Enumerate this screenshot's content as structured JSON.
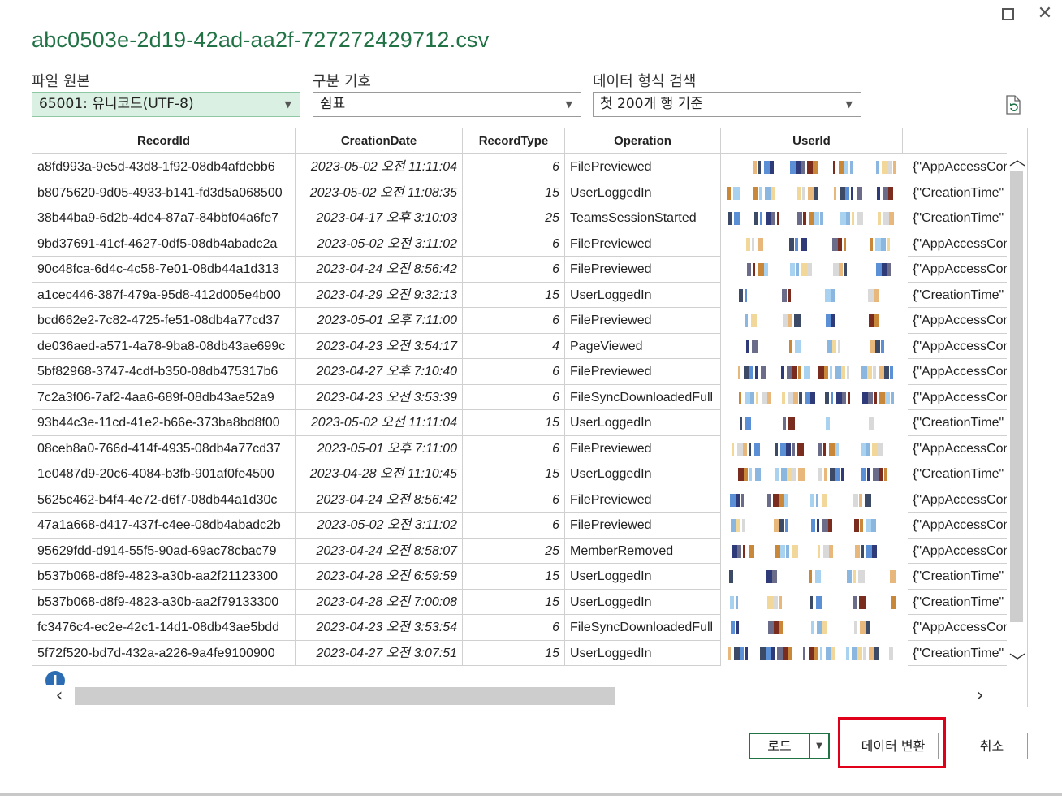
{
  "window": {
    "maximize_icon": "maximize-icon",
    "close_icon": "close-icon",
    "close_glyph": "✕"
  },
  "title": "abc0503e-2d19-42ad-aa2f-727272429712.csv",
  "fields": {
    "file_origin": {
      "label": "파일 원본",
      "value": "65001: 유니코드(UTF-8)"
    },
    "delimiter": {
      "label": "구분 기호",
      "value": "쉼표"
    },
    "type_detection": {
      "label": "데이터 형식 검색",
      "value": "첫 200개 행 기준"
    }
  },
  "columns": [
    "RecordId",
    "CreationDate",
    "RecordType",
    "Operation",
    "UserId"
  ],
  "rows": [
    {
      "id": "a8fd993a-9e5d-43d8-1f92-08db4afdebb6",
      "date": "2023-05-02 오전 11:11:04",
      "type": "6",
      "op": "FilePreviewed",
      "data": "{\"AppAccessCon"
    },
    {
      "id": "b8075620-9d05-4933-b141-fd3d5a068500",
      "date": "2023-05-02 오전 11:08:35",
      "type": "15",
      "op": "UserLoggedIn",
      "data": "{\"CreationTime\""
    },
    {
      "id": "38b44ba9-6d2b-4de4-87a7-84bbf04a6fe7",
      "date": "2023-04-17 오후 3:10:03",
      "type": "25",
      "op": "TeamsSessionStarted",
      "data": "{\"CreationTime\""
    },
    {
      "id": "9bd37691-41cf-4627-0df5-08db4abadc2a",
      "date": "2023-05-02 오전 3:11:02",
      "type": "6",
      "op": "FilePreviewed",
      "data": "{\"AppAccessCon"
    },
    {
      "id": "90c48fca-6d4c-4c58-7e01-08db44a1d313",
      "date": "2023-04-24 오전 8:56:42",
      "type": "6",
      "op": "FilePreviewed",
      "data": "{\"AppAccessCon"
    },
    {
      "id": "a1cec446-387f-479a-95d8-412d005e4b00",
      "date": "2023-04-29 오전 9:32:13",
      "type": "15",
      "op": "UserLoggedIn",
      "data": "{\"CreationTime\""
    },
    {
      "id": "bcd662e2-7c82-4725-fe51-08db4a77cd37",
      "date": "2023-05-01 오후 7:11:00",
      "type": "6",
      "op": "FilePreviewed",
      "data": "{\"AppAccessCon"
    },
    {
      "id": "de036aed-a571-4a78-9ba8-08db43ae699c",
      "date": "2023-04-23 오전 3:54:17",
      "type": "4",
      "op": "PageViewed",
      "data": "{\"AppAccessCon"
    },
    {
      "id": "5bf82968-3747-4cdf-b350-08db475317b6",
      "date": "2023-04-27 오후 7:10:40",
      "type": "6",
      "op": "FilePreviewed",
      "data": "{\"AppAccessCon"
    },
    {
      "id": "7c2a3f06-7af2-4aa6-689f-08db43ae52a9",
      "date": "2023-04-23 오전 3:53:39",
      "type": "6",
      "op": "FileSyncDownloadedFull",
      "data": "{\"AppAccessCon"
    },
    {
      "id": "93b44c3e-11cd-41e2-b66e-373ba8bd8f00",
      "date": "2023-05-02 오전 11:11:04",
      "type": "15",
      "op": "UserLoggedIn",
      "data": "{\"CreationTime\""
    },
    {
      "id": "08ceb8a0-766d-414f-4935-08db4a77cd37",
      "date": "2023-05-01 오후 7:11:00",
      "type": "6",
      "op": "FilePreviewed",
      "data": "{\"AppAccessCon"
    },
    {
      "id": "1e0487d9-20c6-4084-b3fb-901af0fe4500",
      "date": "2023-04-28 오전 11:10:45",
      "type": "15",
      "op": "UserLoggedIn",
      "data": "{\"CreationTime\""
    },
    {
      "id": "5625c462-b4f4-4e72-d6f7-08db44a1d30c",
      "date": "2023-04-24 오전 8:56:42",
      "type": "6",
      "op": "FilePreviewed",
      "data": "{\"AppAccessCon"
    },
    {
      "id": "47a1a668-d417-437f-c4ee-08db4abadc2b",
      "date": "2023-05-02 오전 3:11:02",
      "type": "6",
      "op": "FilePreviewed",
      "data": "{\"AppAccessCon"
    },
    {
      "id": "95629fdd-d914-55f5-90ad-69ac78cbac79",
      "date": "2023-04-24 오전 8:58:07",
      "type": "25",
      "op": "MemberRemoved",
      "data": "{\"AppAccessCon"
    },
    {
      "id": "b537b068-d8f9-4823-a30b-aa2f21123300",
      "date": "2023-04-28 오전 6:59:59",
      "type": "15",
      "op": "UserLoggedIn",
      "data": "{\"CreationTime\""
    },
    {
      "id": "b537b068-d8f9-4823-a30b-aa2f79133300",
      "date": "2023-04-28 오전 7:00:08",
      "type": "15",
      "op": "UserLoggedIn",
      "data": "{\"CreationTime\""
    },
    {
      "id": "fc3476c4-ec2e-42c1-14d1-08db43ae5bdd",
      "date": "2023-04-23 오전 3:53:54",
      "type": "6",
      "op": "FileSyncDownloadedFull",
      "data": "{\"AppAccessCon"
    },
    {
      "id": "5f72f520-bd7d-432a-a226-9a4fe9100900",
      "date": "2023-04-27 오전 3:07:51",
      "type": "15",
      "op": "UserLoggedIn",
      "data": "{\"CreationTime\""
    }
  ],
  "buttons": {
    "load": "로드",
    "transform": "데이터 변환",
    "cancel": "취소"
  },
  "colors": {
    "accent": "#217346",
    "highlight": "#e1001a"
  }
}
